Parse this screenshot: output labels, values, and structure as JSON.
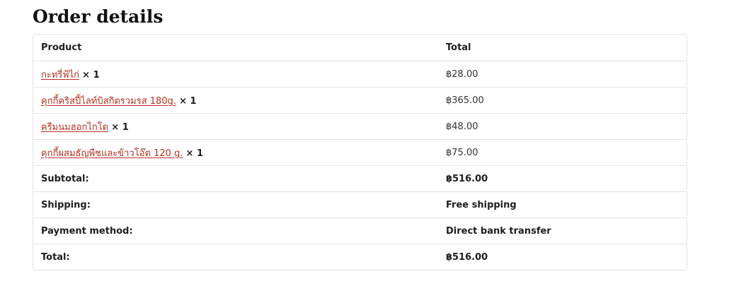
{
  "page": {
    "heading": "Order details"
  },
  "table": {
    "headers": {
      "product": "Product",
      "total": "Total"
    },
    "items": [
      {
        "name": "กะทรี่ฟ้ไก่",
        "qty": "× 1",
        "total": "฿28.00"
      },
      {
        "name": "คุกกี้คริสปี้ไลท์บิสกิตรวมรส 180g.",
        "qty": "× 1",
        "total": "฿365.00"
      },
      {
        "name": "ครีมนมฮอกไกโด",
        "qty": "× 1",
        "total": "฿48.00"
      },
      {
        "name": "คุกกี้ผสมธัญพืชและข้าวโอ๊ต 120 g.",
        "qty": "× 1",
        "total": "฿75.00"
      }
    ],
    "summary": {
      "subtotal_label": "Subtotal:",
      "subtotal_value": "฿516.00",
      "shipping_label": "Shipping:",
      "shipping_value": "Free shipping",
      "payment_label": "Payment method:",
      "payment_value": "Direct bank transfer",
      "total_label": "Total:",
      "total_value": "฿516.00"
    }
  },
  "colors": {
    "link": "#b5301e",
    "border": "#e3e3e3",
    "text": "#1e1e1e"
  }
}
